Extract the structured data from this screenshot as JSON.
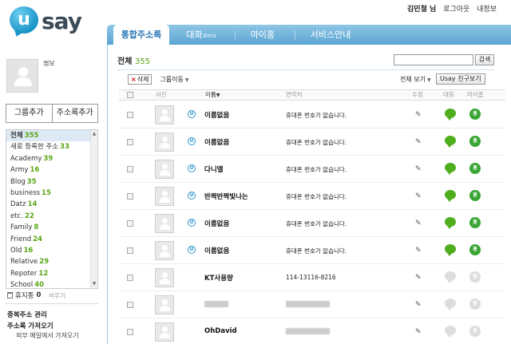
{
  "logo": {
    "letter": "u",
    "word": "say"
  },
  "topnav": {
    "user": "김민철 님",
    "logout": "로그아웃",
    "myinfo": "내정보"
  },
  "profile": {
    "name": "썸보"
  },
  "left_buttons": {
    "add_group": "그룹추가",
    "add_contact": "주소록추가"
  },
  "groups": [
    {
      "label": "전체",
      "count": "355",
      "active": true
    },
    {
      "label": "새로 등록한 주소",
      "count": "33"
    },
    {
      "label": "Academy",
      "count": "39"
    },
    {
      "label": "Army",
      "count": "16"
    },
    {
      "label": "Blog",
      "count": "35"
    },
    {
      "label": "business",
      "count": "15"
    },
    {
      "label": "Datz",
      "count": "14"
    },
    {
      "label": "etc.",
      "count": "22"
    },
    {
      "label": "Family",
      "count": "8"
    },
    {
      "label": "Friend",
      "count": "24"
    },
    {
      "label": "Old",
      "count": "16"
    },
    {
      "label": "Relative",
      "count": "29"
    },
    {
      "label": "Repoter",
      "count": "12"
    },
    {
      "label": "School",
      "count": "40"
    }
  ],
  "trash": {
    "label": "휴지통",
    "count": "0",
    "empty": "비우기"
  },
  "left_links": {
    "dup": "중복주소 관리",
    "import": "주소록 가져오기",
    "external": "외부 메일에서 가져오기"
  },
  "tabs": [
    {
      "label": "통합주소록",
      "active": true
    },
    {
      "label": "대화",
      "beta": "Beta"
    },
    {
      "label": "마이홈"
    },
    {
      "label": "서비스안내"
    }
  ],
  "content": {
    "title": "전체",
    "count": "355",
    "search_btn": "검색",
    "delete_btn": "삭제",
    "group_move": "그룹이동",
    "view_all": "전체 보기",
    "friend_btn": "Usay 친구보기"
  },
  "columns": {
    "photo": "사진",
    "name": "이름",
    "contact": "연락처",
    "edit": "수정",
    "chat": "대화",
    "myhome": "마이홈"
  },
  "rows": [
    {
      "name": "이름없음",
      "phone": "휴대폰 번호가 없습니다.",
      "usay": true
    },
    {
      "name": "이름없음",
      "phone": "휴대폰 번호가 없습니다.",
      "usay": true
    },
    {
      "name": "다니엘",
      "phone": "휴대폰 번호가 없습니다.",
      "usay": true
    },
    {
      "name": "반짝반짝빛나는",
      "phone": "휴대폰 번호가 없습니다.",
      "usay": true
    },
    {
      "name": "이름없음",
      "phone": "휴대폰 번호가 없습니다.",
      "usay": true
    },
    {
      "name": "이름없음",
      "phone": "휴대폰 번호가 없습니다.",
      "usay": true
    },
    {
      "name": "KT사용량",
      "phone": "114-13116-8216",
      "usay": false
    },
    {
      "name": "",
      "phone": "",
      "usay": false,
      "blurred": true
    },
    {
      "name": "OhDavid",
      "phone": "",
      "usay": false,
      "blurred_phone": true
    }
  ],
  "icons": {
    "mh_icon_text": "홈"
  }
}
